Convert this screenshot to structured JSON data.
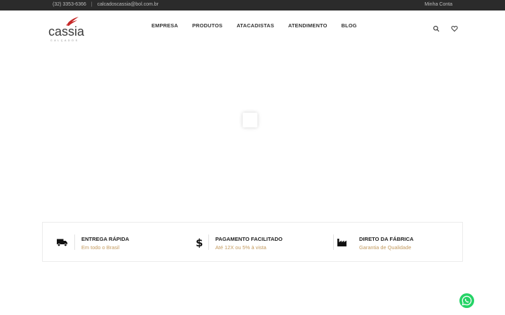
{
  "topbar": {
    "phone": "(32) 3353-6366",
    "separator": "|",
    "email": "calcadoscassia@bol.com.br",
    "account_label": "Minha Conta"
  },
  "header": {
    "logo_text": "cassia",
    "logo_subtext": "CALÇADOS",
    "logo_accent_color": "#c62828",
    "nav": [
      "EMPRESA",
      "PRODUTOS",
      "ATACADISTAS",
      "ATENDIMENTO",
      "BLOG"
    ],
    "icons": [
      "search-icon",
      "heart-icon"
    ]
  },
  "features": [
    {
      "icon": "truck-icon",
      "title": "ENTREGA RÁPIDA",
      "subtitle": "Em todo o Brasil"
    },
    {
      "icon": "dollar-icon",
      "title": "PAGAMENTO FACILITADO",
      "subtitle": "Até 12X ou 5% à vista"
    },
    {
      "icon": "factory-icon",
      "title": "DIRETO DA FÁBRICA",
      "subtitle": "Garantia de Qualidade"
    }
  ],
  "colors": {
    "topbar_bg": "#2b2b2b",
    "subtitle_gold": "#c39a5e",
    "whatsapp_green": "#25d366"
  },
  "floating": {
    "icon": "whatsapp-icon"
  }
}
